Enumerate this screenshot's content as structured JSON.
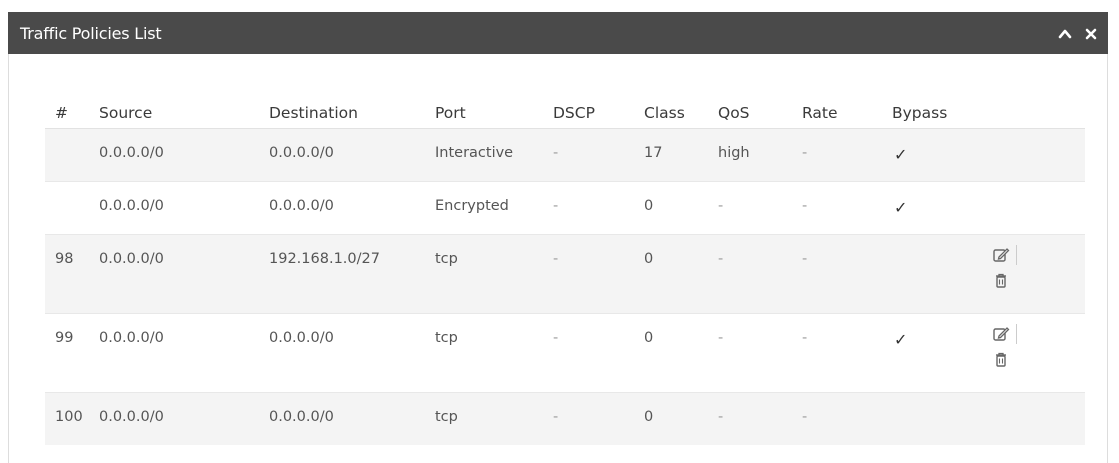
{
  "panel": {
    "title": "Traffic Policies List"
  },
  "table": {
    "headers": [
      "#",
      "Source",
      "Destination",
      "Port",
      "DSCP",
      "Class",
      "QoS",
      "Rate",
      "Bypass"
    ],
    "rows": [
      {
        "num": "",
        "source": "0.0.0.0/0",
        "destination": "0.0.0.0/0",
        "port": "Interactive",
        "dscp": "-",
        "class": "17",
        "qos": "high",
        "rate": "-",
        "bypass": "✓",
        "has_actions": false
      },
      {
        "num": "",
        "source": "0.0.0.0/0",
        "destination": "0.0.0.0/0",
        "port": "Encrypted",
        "dscp": "-",
        "class": "0",
        "qos": "-",
        "rate": "-",
        "bypass": "✓",
        "has_actions": false
      },
      {
        "num": "98",
        "source": "0.0.0.0/0",
        "destination": "192.168.1.0/27",
        "port": "tcp",
        "dscp": "-",
        "class": "0",
        "qos": "-",
        "rate": "-",
        "bypass": "",
        "has_actions": true
      },
      {
        "num": "99",
        "source": "0.0.0.0/0",
        "destination": "0.0.0.0/0",
        "port": "tcp",
        "dscp": "-",
        "class": "0",
        "qos": "-",
        "rate": "-",
        "bypass": "✓",
        "has_actions": true
      },
      {
        "num": "100",
        "source": "0.0.0.0/0",
        "destination": "0.0.0.0/0",
        "port": "tcp",
        "dscp": "-",
        "class": "0",
        "qos": "-",
        "rate": "-",
        "bypass": "",
        "has_actions": false
      }
    ]
  },
  "icons": {
    "collapse": "chevron-up-icon",
    "close": "close-icon",
    "edit": "edit-icon",
    "delete": "trash-icon"
  },
  "colors": {
    "header_bg": "#4a4a4a",
    "header_text": "#ffffff",
    "row_alt": "#f4f4f4"
  }
}
